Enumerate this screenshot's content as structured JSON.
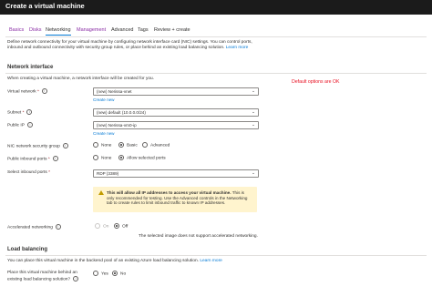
{
  "window": {
    "title": "Create a virtual machine"
  },
  "tabs": [
    {
      "label": "Basics"
    },
    {
      "label": "Disks"
    },
    {
      "label": "Networking"
    },
    {
      "label": "Management"
    },
    {
      "label": "Advanced"
    },
    {
      "label": "Tags"
    },
    {
      "label": "Review + create"
    }
  ],
  "description": {
    "text": "Define network connectivity for your virtual machine by configuring network interface card (NIC) settings. You can control ports, inbound and outbound connectivity with security group rules, or place behind an existing load balancing solution.",
    "learn_more": "Learn more"
  },
  "network_interface": {
    "heading": "Network interface",
    "intro": "When creating a virtual machine, a network interface will be created for you.",
    "virtual_network": {
      "label": "Virtual network",
      "value": "(new) Nerissa-vnet",
      "create_new": "Create new"
    },
    "subnet": {
      "label": "Subnet",
      "value": "(new) default (10.0.0.0/24)"
    },
    "public_ip": {
      "label": "Public IP",
      "value": "(new) Nerissa-vm0-ip",
      "create_new": "Create new"
    },
    "nsg": {
      "label": "NIC network security group",
      "options": [
        "None",
        "Basic",
        "Advanced"
      ],
      "selected": "Basic"
    },
    "public_inbound_ports": {
      "label": "Public inbound ports",
      "options": [
        "None",
        "Allow selected ports"
      ],
      "selected": "Allow selected ports"
    },
    "select_inbound_ports": {
      "label": "Select inbound ports",
      "value": "RDP (3389)"
    },
    "warning": {
      "bold": "This will allow all IP addresses to access your virtual machine.",
      "text": " This is only recommended for testing. Use the Advanced controls in the Networking tab to create rules to limit inbound traffic to known IP addresses."
    },
    "accelerated_networking": {
      "label": "Accelerated networking",
      "options": [
        "On",
        "Off"
      ],
      "selected": "Off",
      "note": "The selected image does not support accelerated networking."
    }
  },
  "load_balancing": {
    "heading": "Load balancing",
    "intro": "You can place this virtual machine in the backend pool of an existing Azure load balancing solution.",
    "learn_more": "Learn more",
    "question": {
      "label_line1": "Place this virtual machine behind an",
      "label_line2": "existing load balancing solution?",
      "options": [
        "Yes",
        "No"
      ],
      "selected": "No"
    }
  },
  "annotation": {
    "text": "Default options are OK",
    "color": "#e81123"
  },
  "colors": {
    "accent": "#0078d4",
    "titlebar": "#1b1b1b",
    "warning_bg": "#fff4ce"
  },
  "icons": {
    "info": "info-icon",
    "warning": "warning-icon",
    "chevron": "chevron-down-icon"
  }
}
